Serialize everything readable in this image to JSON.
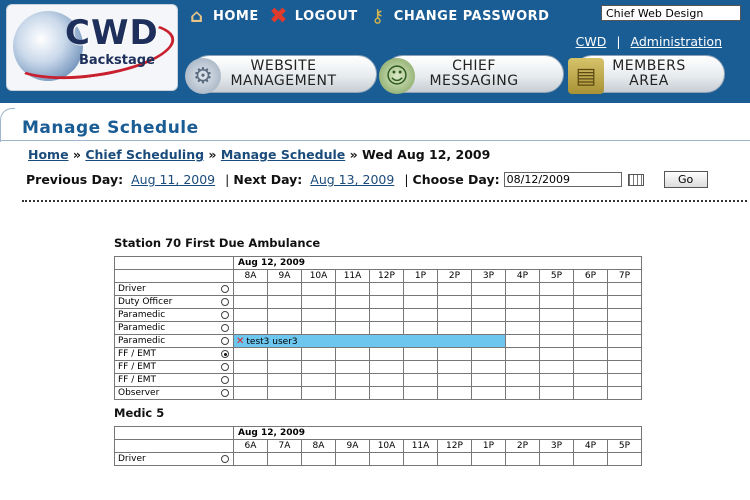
{
  "header": {
    "logo_main": "CWD",
    "logo_sub": "Backstage",
    "nav": [
      {
        "label": "HOME",
        "icon": "house-icon"
      },
      {
        "label": "LOGOUT",
        "icon": "x-icon"
      },
      {
        "label": "CHANGE PASSWORD",
        "icon": "keys-icon"
      }
    ],
    "site_name": "Chief Web Design",
    "sublinks": {
      "cwd": "CWD",
      "separator": "|",
      "administration": "Administration"
    },
    "tabs": [
      {
        "line1": "WEBSITE",
        "line2": "MANAGEMENT",
        "icon": "gear-icon"
      },
      {
        "line1": "CHIEF",
        "line2": "MESSAGING",
        "icon": "people-icon"
      },
      {
        "line1": "MEMBERS",
        "line2": "AREA",
        "icon": "cabinet-icon"
      }
    ]
  },
  "page": {
    "title": "Manage Schedule",
    "breadcrumb": {
      "home": "Home",
      "sep": "»",
      "scheduling": "Chief Scheduling",
      "manage": "Manage Schedule",
      "current": "Wed Aug 12, 2009"
    },
    "daynav": {
      "prev_label": "Previous Day:",
      "prev_value": "Aug 11, 2009",
      "pipe": "|",
      "next_label": "Next Day:",
      "next_value": "Aug 13, 2009",
      "choose_label": "Choose Day:",
      "choose_value": "08/12/2009",
      "go": "Go"
    }
  },
  "schedules": [
    {
      "name": "Station 70 First Due Ambulance",
      "date": "Aug 12, 2009",
      "hours": [
        "8A",
        "9A",
        "10A",
        "11A",
        "12P",
        "1P",
        "2P",
        "3P",
        "4P",
        "5P",
        "6P",
        "7P"
      ],
      "rows": [
        {
          "role": "Driver",
          "selected": false
        },
        {
          "role": "Duty Officer",
          "selected": false
        },
        {
          "role": "Paramedic",
          "selected": false
        },
        {
          "role": "Paramedic",
          "selected": false
        },
        {
          "role": "Paramedic",
          "selected": false,
          "booking": {
            "name": "test3 user3",
            "start_slot": 0,
            "span_slots": 8
          }
        },
        {
          "role": "FF / EMT",
          "selected": true
        },
        {
          "role": "FF / EMT",
          "selected": false
        },
        {
          "role": "FF / EMT",
          "selected": false
        },
        {
          "role": "Observer",
          "selected": false
        }
      ]
    },
    {
      "name": "Medic 5",
      "date": "Aug 12, 2009",
      "hours": [
        "6A",
        "7A",
        "8A",
        "9A",
        "10A",
        "11A",
        "12P",
        "1P",
        "2P",
        "3P",
        "4P",
        "5P"
      ],
      "rows": [
        {
          "role": "Driver",
          "selected": false
        }
      ]
    }
  ]
}
